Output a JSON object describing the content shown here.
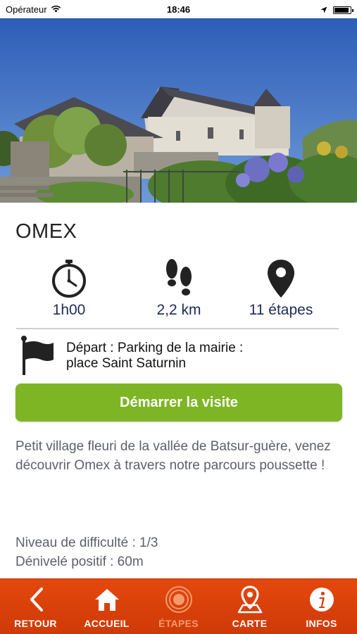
{
  "status_bar": {
    "carrier": "Opérateur",
    "time": "18:46"
  },
  "place": {
    "title": "OMEX"
  },
  "stats": {
    "duration": "1h00",
    "distance": "2,2 km",
    "stages": "11 étapes"
  },
  "departure": {
    "line1": "Départ : Parking de la mairie :",
    "line2": "place Saint Saturnin"
  },
  "start_button": "Démarrer la visite",
  "description": "Petit village fleuri de la vallée de Batsur-guère, venez découvrir Omex à travers notre parcours poussette !",
  "info": {
    "difficulty": "Niveau de difficulté : 1/3",
    "elevation": "Dénivelé positif : 60m"
  },
  "tabbar": {
    "back": "RETOUR",
    "home": "ACCUEIL",
    "stages": "ÉTAPES",
    "map": "CARTE",
    "info": "INFOS"
  },
  "colors": {
    "accent_green": "#7db524",
    "tabbar_orange": "#dc420b",
    "stat_text": "#1e2a5a"
  }
}
